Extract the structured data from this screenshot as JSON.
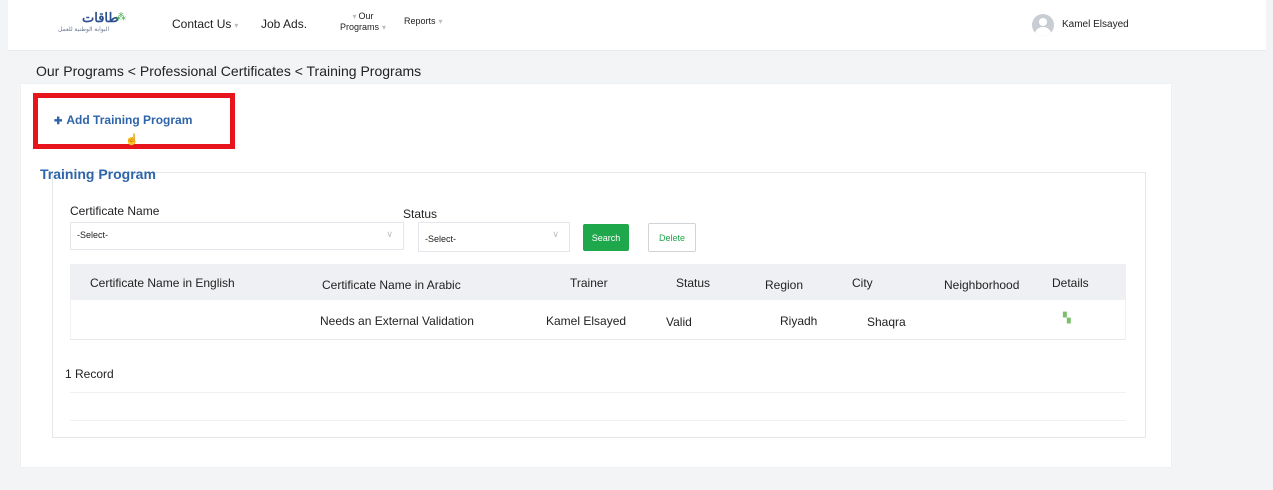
{
  "header": {
    "logo_text_ar": "طاقات",
    "logo_subtext_ar": "البوابة الوطنية للعمل",
    "nav": {
      "contact_us": "Contact Us",
      "job_ads": "Job Ads.",
      "our_programs_line1": "Our",
      "our_programs_line2": "Programs",
      "reports": "Reports"
    },
    "user_name": "Kamel Elsayed"
  },
  "breadcrumb": "Our Programs < Professional Certificates < Training Programs",
  "add_button_label": "Add Training Program",
  "section_title": "Training Program",
  "filters": {
    "certificate_name_label": "Certificate Name",
    "certificate_name_value": "-Select-",
    "status_label": "Status",
    "status_value": "-Select-",
    "search_label": "Search",
    "delete_label": "Delete"
  },
  "table": {
    "columns": [
      "Certificate Name in English",
      "Certificate Name in Arabic",
      "Trainer",
      "Status",
      "Region",
      "City",
      "Neighborhood",
      "Details"
    ],
    "rows": [
      [
        "",
        "Needs an External Validation",
        "Kamel Elsayed",
        "Valid",
        "Riyadh",
        "Shaqra",
        "",
        ""
      ]
    ]
  },
  "record_count": "1 Record",
  "colors": {
    "accent_blue": "#2e64a8",
    "search_green": "#1fa84b",
    "highlight_red": "#e8141b"
  }
}
